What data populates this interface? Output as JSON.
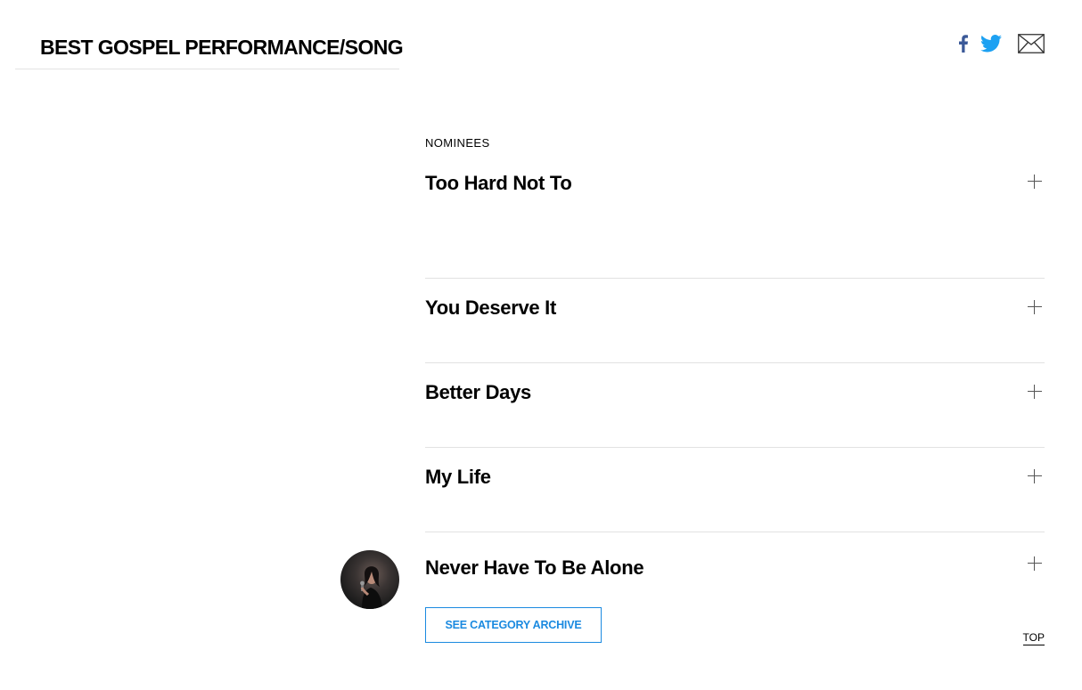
{
  "category": {
    "title": "BEST GOSPEL PERFORMANCE/SONG"
  },
  "share": {
    "facebook_icon": "facebook-icon",
    "twitter_icon": "twitter-icon",
    "email_icon": "email-icon",
    "colors": {
      "facebook": "#3b5998",
      "twitter": "#1da1f2",
      "email": "#333333"
    }
  },
  "nominees": {
    "label": "NOMINEES",
    "items": [
      {
        "title": "Too Hard Not To"
      },
      {
        "title": "You Deserve It"
      },
      {
        "title": "Better Days"
      },
      {
        "title": "My Life"
      },
      {
        "title": "Never Have To Be Alone"
      }
    ],
    "expand_icon": "plus-icon"
  },
  "archive_button": {
    "label": "SEE CATEGORY ARCHIVE",
    "color": "#1b8ae0"
  },
  "top_link": {
    "label": "TOP"
  }
}
